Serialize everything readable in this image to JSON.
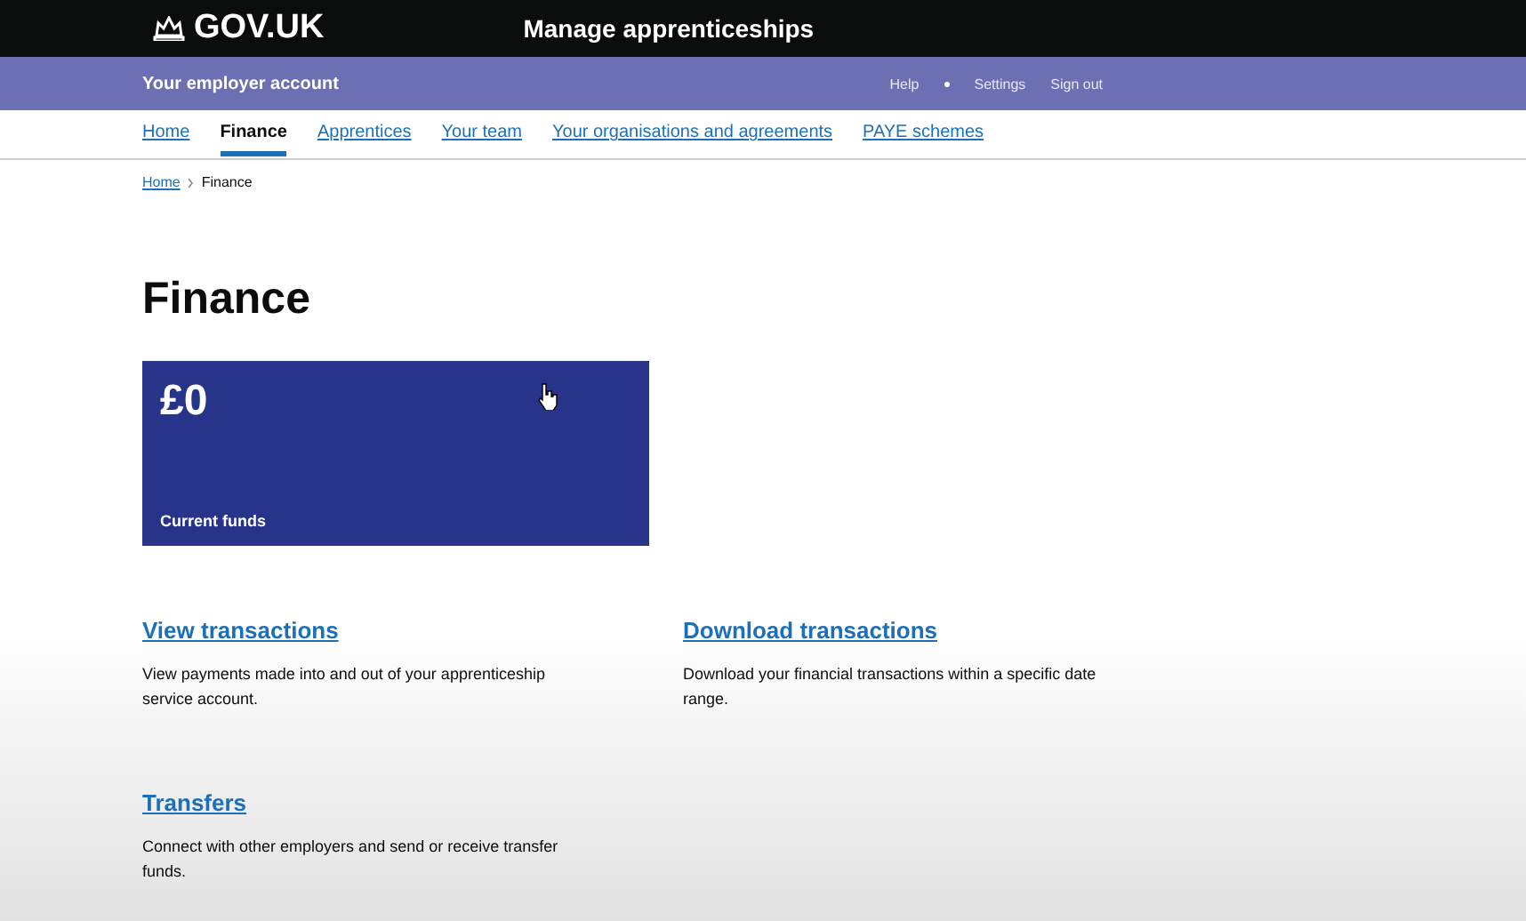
{
  "header": {
    "logo": "GOV.UK",
    "service": "Manage apprenticeships"
  },
  "account_bar": {
    "title": "Your employer account",
    "links": [
      {
        "label": "Help",
        "kind": "plain"
      },
      {
        "label": "Settings",
        "kind": "dot"
      },
      {
        "label": "Sign out",
        "kind": "plain"
      }
    ]
  },
  "nav": [
    {
      "label": "Home",
      "selected": false
    },
    {
      "label": "Finance",
      "selected": true
    },
    {
      "label": "Apprentices",
      "selected": false
    },
    {
      "label": "Your team",
      "selected": false
    },
    {
      "label": "Your organisations and agreements",
      "selected": false
    },
    {
      "label": "PAYE schemes",
      "selected": false
    }
  ],
  "breadcrumbs": [
    {
      "label": "Home",
      "kind": "link"
    },
    {
      "label": "Finance",
      "kind": "current"
    }
  ],
  "title": "Finance",
  "funds": {
    "amount": "£0",
    "label": "Current funds"
  },
  "actions": [
    {
      "title": "View transactions",
      "description": "View payments made into and out of your apprenticeship service account."
    },
    {
      "title": "Download transactions",
      "description": "Download your financial transactions within a specific date range."
    },
    {
      "title": "Transfers",
      "description": "Connect with other employers and send or receive transfer funds."
    }
  ]
}
